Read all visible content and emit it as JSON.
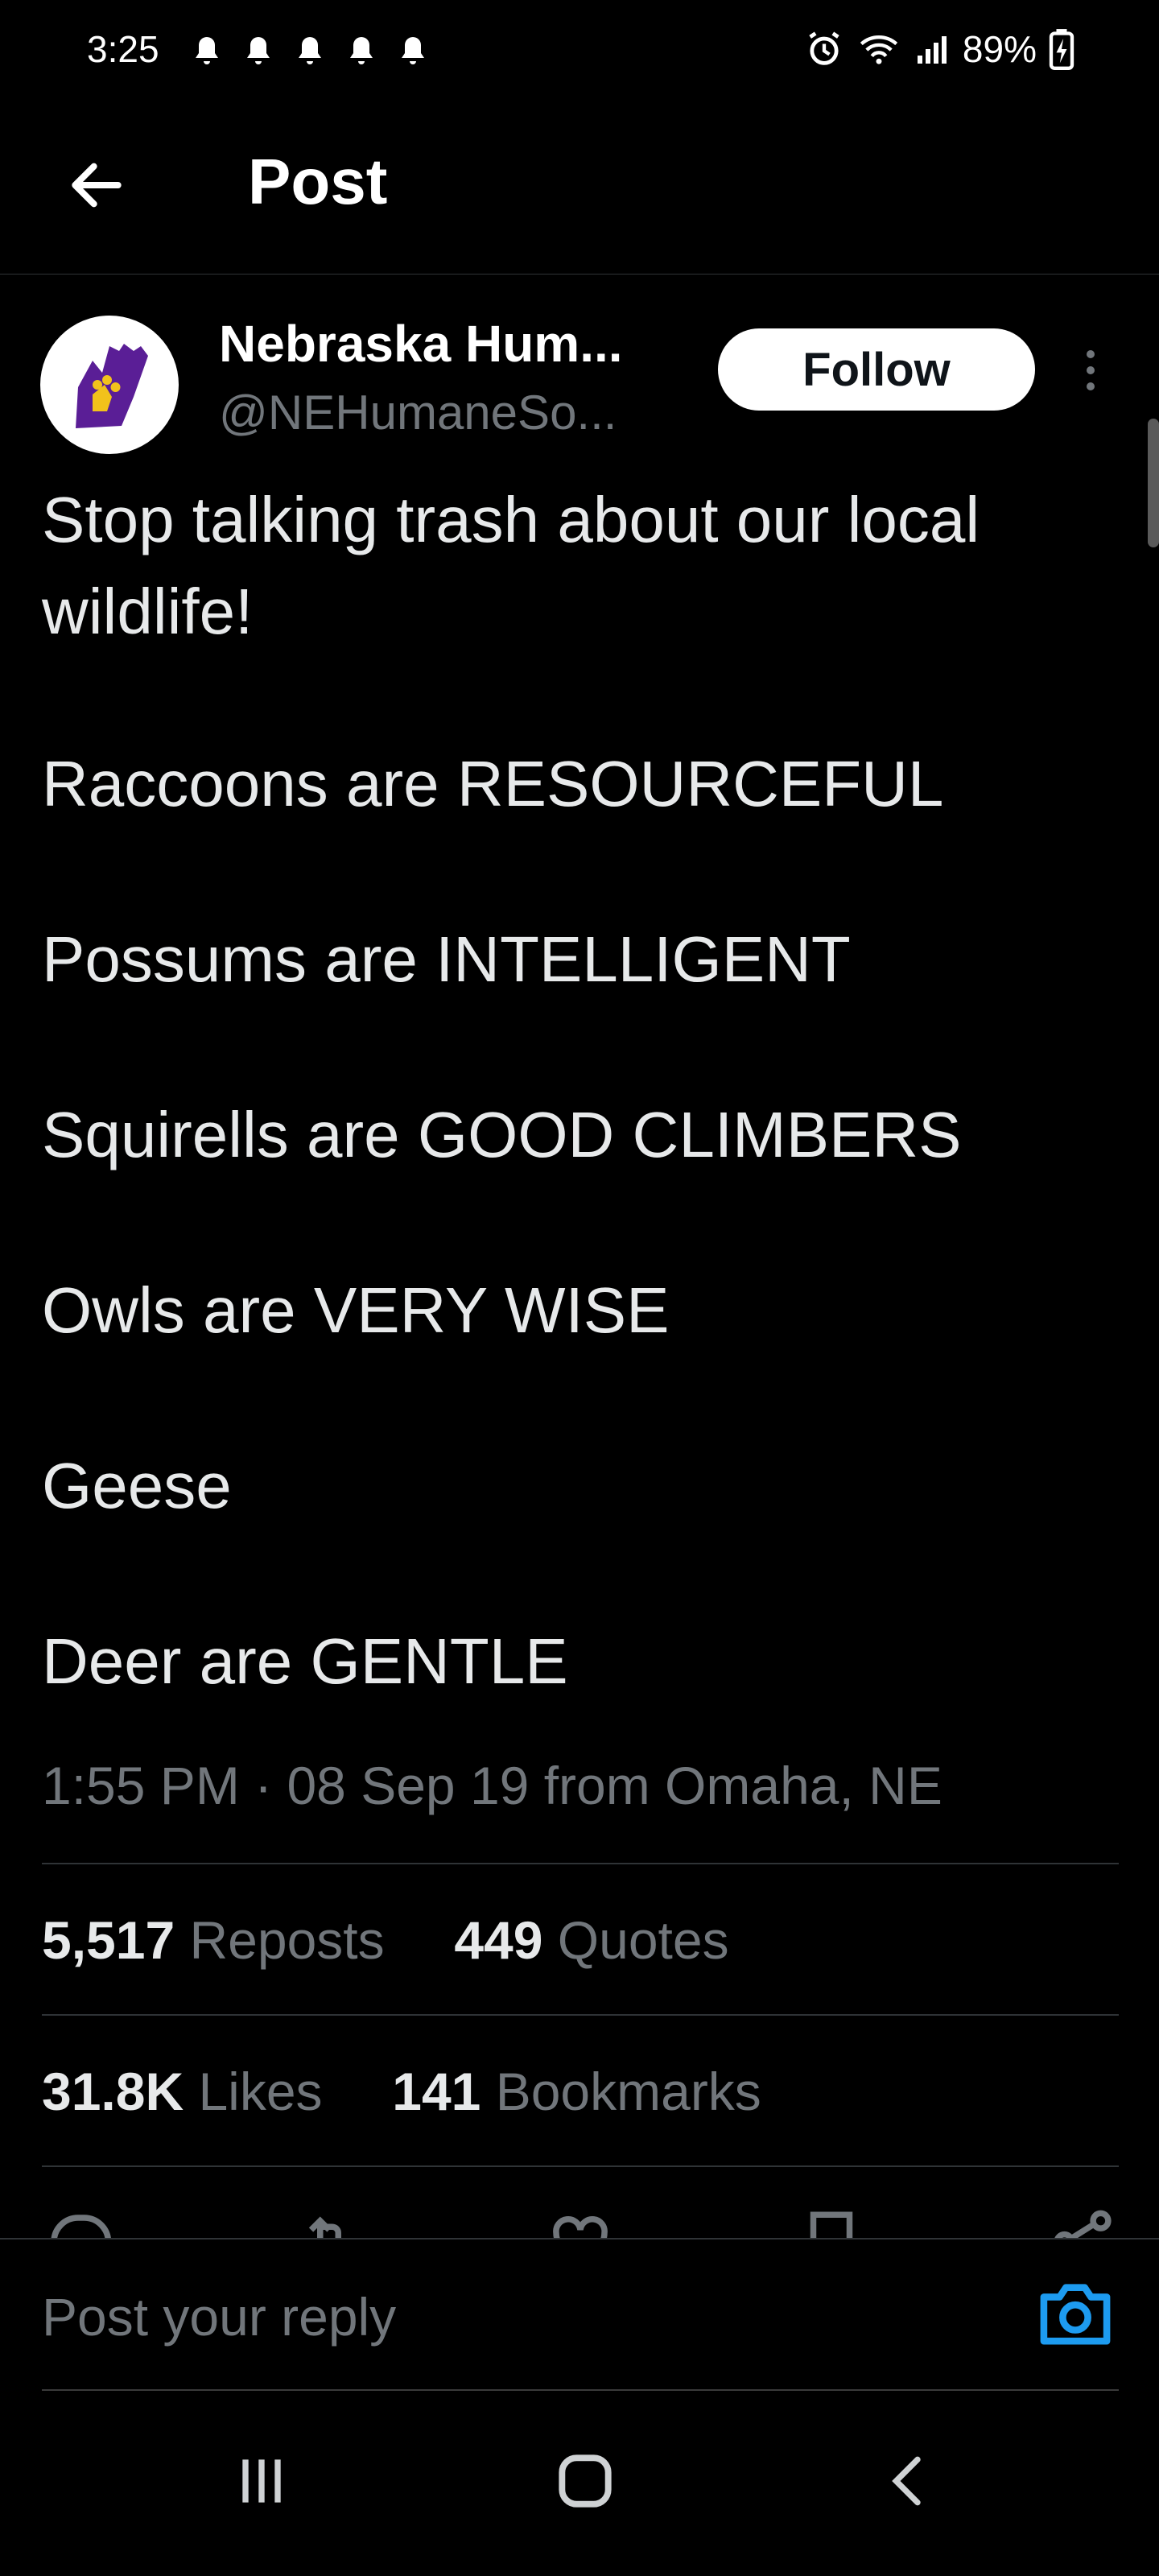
{
  "status_bar": {
    "time": "3:25",
    "battery": "89%",
    "icons": [
      "notification-bell-icon",
      "alarm-icon",
      "wifi-icon",
      "signal-icon",
      "battery-charging-icon"
    ]
  },
  "header": {
    "title": "Post",
    "back_icon": "arrow-left-icon"
  },
  "author": {
    "name": "Nebraska Hum...",
    "handle": "@NEHumaneSo...",
    "follow_label": "Follow",
    "avatar_colors": {
      "hand": "#5a1e96",
      "paw": "#f2c21b"
    }
  },
  "post": {
    "lines": [
      "Stop talking trash about our local",
      "wildlife!",
      "Raccoons are RESOURCEFUL",
      "Possums are INTELLIGENT",
      "Squirells are GOOD CLIMBERS",
      "Owls are VERY WISE",
      "Geese",
      "Deer are GENTLE"
    ],
    "meta": "1:55 PM · 08 Sep 19 from Omaha, NE"
  },
  "stats": {
    "reposts_count": "5,517",
    "reposts_label": "Reposts",
    "quotes_count": "449",
    "quotes_label": "Quotes",
    "likes_count": "31.8K",
    "likes_label": "Likes",
    "bookmarks_count": "141",
    "bookmarks_label": "Bookmarks"
  },
  "reply": {
    "placeholder": "Post your reply",
    "accent": "#1d9bf0"
  }
}
